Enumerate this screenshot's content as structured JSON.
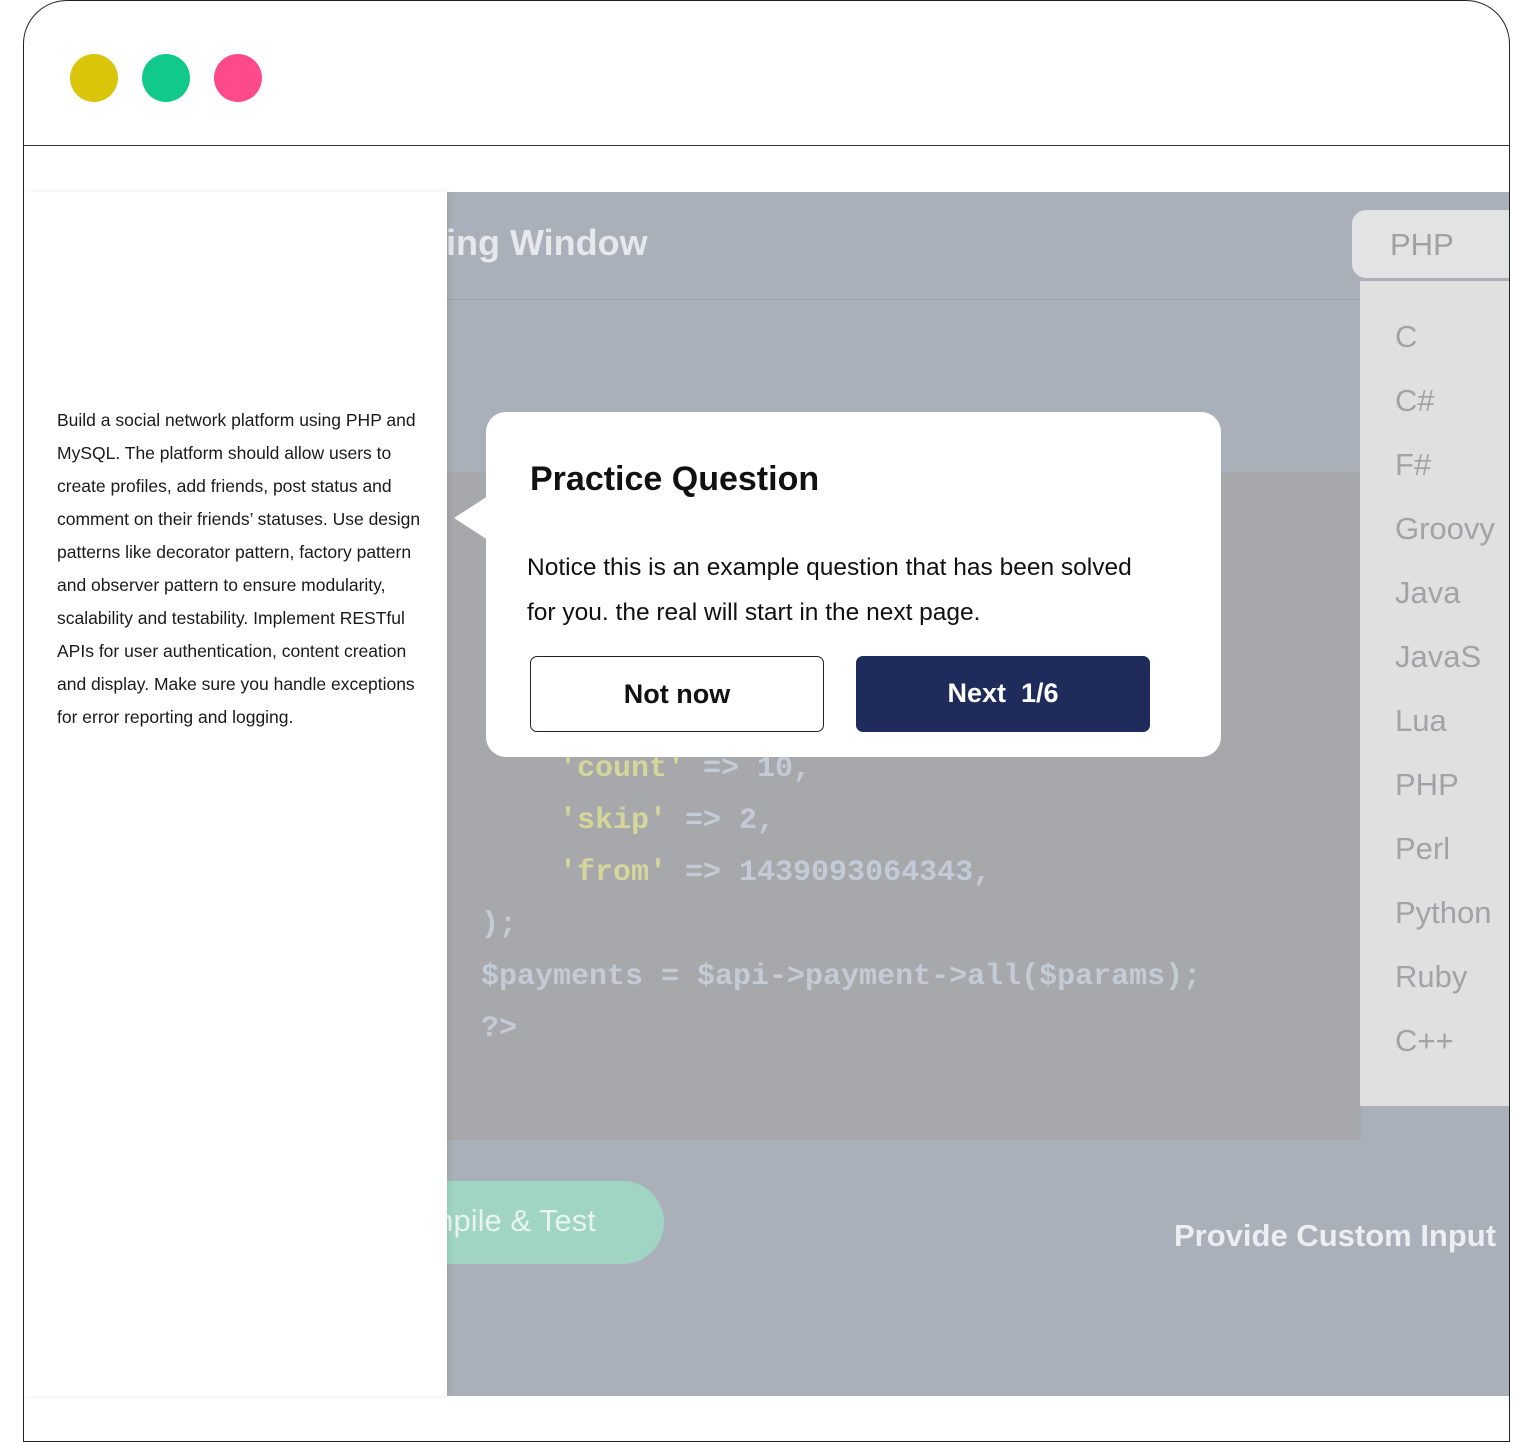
{
  "window": {
    "controls": [
      {
        "name": "minimize",
        "color": "#d9c50a"
      },
      {
        "name": "maximize",
        "color": "#10c98a"
      },
      {
        "name": "close",
        "color": "#fe4a8a"
      }
    ]
  },
  "header": {
    "title": "Coding Window"
  },
  "language": {
    "selected": "PHP",
    "options": [
      "C",
      "C#",
      "F#",
      "Groovy",
      "Java",
      "JavaS",
      "Lua",
      "PHP",
      "Perl",
      "Python",
      "Ruby",
      "C++"
    ]
  },
  "code": {
    "lines": [
      "    'count' => 10,",
      "    'skip' => 2,",
      "    'from' => 1439093064343,",
      ");",
      "$payments = $api->payment->all($params);",
      "?>"
    ]
  },
  "actions": {
    "compile": "Compile & Test",
    "custom_input": "Provide Custom Input"
  },
  "question": {
    "text": "Build a social network platform using PHP and MySQL. The platform should allow users to create profiles, add friends, post status and comment on their friends’ statuses. Use design patterns like decorator pattern, factory pattern and observer pattern to ensure modularity, scalability and testability. Implement RESTful APIs for user authentication, content creation and display. Make sure you handle exceptions for error reporting and logging."
  },
  "popup": {
    "title": "Practice Question",
    "body": "Notice this is an example question that has been solved for you. the real will start in the next page.",
    "not_now": "Not now",
    "next": "Next  1/6",
    "accent": "#1f2b5a"
  }
}
